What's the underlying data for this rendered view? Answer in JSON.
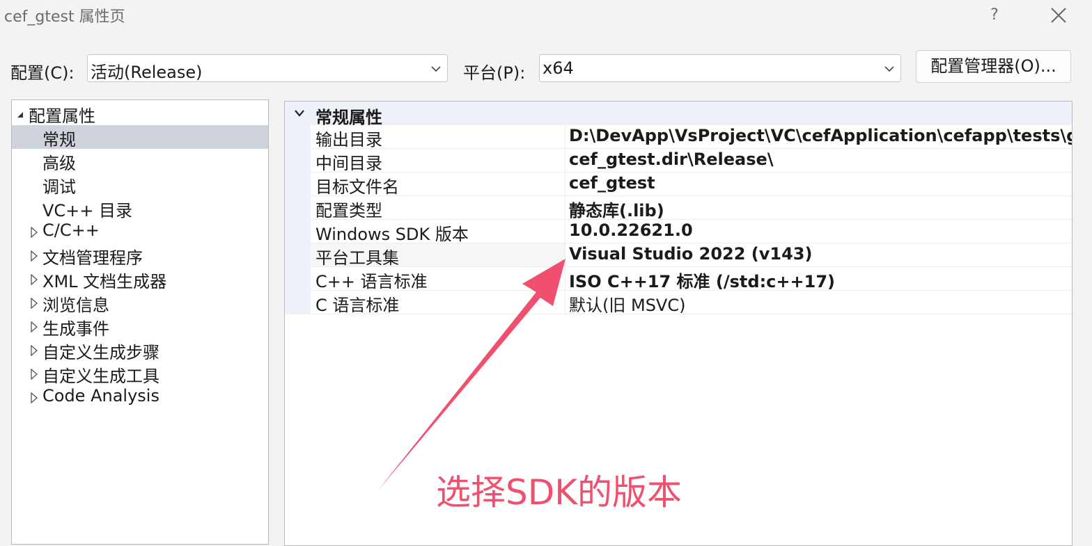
{
  "window": {
    "title": "cef_gtest 属性页",
    "help_label": "?"
  },
  "config_row": {
    "config_label": "配置(C):",
    "config_value": "活动(Release)",
    "platform_label": "平台(P):",
    "platform_value": "x64",
    "manager_button": "配置管理器(O)..."
  },
  "tree": {
    "root": "配置属性",
    "items": [
      {
        "label": "常规",
        "selected": true,
        "expandable": false
      },
      {
        "label": "高级",
        "selected": false,
        "expandable": false
      },
      {
        "label": "调试",
        "selected": false,
        "expandable": false
      },
      {
        "label": "VC++ 目录",
        "selected": false,
        "expandable": false
      },
      {
        "label": "C/C++",
        "selected": false,
        "expandable": true
      },
      {
        "label": "文档管理程序",
        "selected": false,
        "expandable": true
      },
      {
        "label": "XML 文档生成器",
        "selected": false,
        "expandable": true
      },
      {
        "label": "浏览信息",
        "selected": false,
        "expandable": true
      },
      {
        "label": "生成事件",
        "selected": false,
        "expandable": true
      },
      {
        "label": "自定义生成步骤",
        "selected": false,
        "expandable": true
      },
      {
        "label": "自定义生成工具",
        "selected": false,
        "expandable": true
      },
      {
        "label": "Code Analysis",
        "selected": false,
        "expandable": true
      }
    ]
  },
  "grid": {
    "group": "常规属性",
    "rows": [
      {
        "name": "输出目录",
        "value": "D:\\DevApp\\VsProject\\VC\\cefApplication\\cefapp\\tests\\gtest",
        "bold": true
      },
      {
        "name": "中间目录",
        "value": "cef_gtest.dir\\Release\\",
        "bold": true
      },
      {
        "name": "目标文件名",
        "value": "cef_gtest",
        "bold": true
      },
      {
        "name": "配置类型",
        "value": "静态库(.lib)",
        "bold": true
      },
      {
        "name": "Windows SDK 版本",
        "value": "10.0.22621.0",
        "bold": true
      },
      {
        "name": "平台工具集",
        "value": "Visual Studio 2022 (v143)",
        "bold": true
      },
      {
        "name": "C++ 语言标准",
        "value": "ISO C++17 标准 (/std:c++17)",
        "bold": true
      },
      {
        "name": "C 语言标准",
        "value": "默认(旧 MSVC)",
        "bold": false
      }
    ]
  },
  "annotation": {
    "text": "选择SDK的版本",
    "color": "#f0506e"
  },
  "icons": {
    "close": "close-icon",
    "chevron": "chevron-down-icon",
    "expand": "triangle-right-icon",
    "collapse": "triangle-down-icon"
  }
}
